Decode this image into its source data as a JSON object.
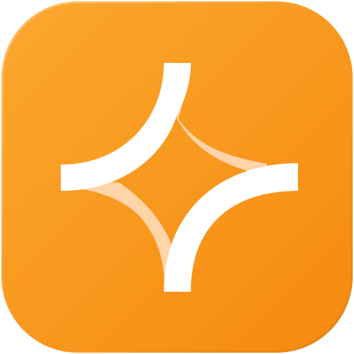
{
  "app_icon": {
    "name": "sparkle-app-icon",
    "colors": {
      "gradient_start": "#FBA82E",
      "gradient_end": "#F6890F",
      "glyph_primary": "#FFFFFF",
      "glyph_secondary": "#FFD4A8"
    }
  }
}
